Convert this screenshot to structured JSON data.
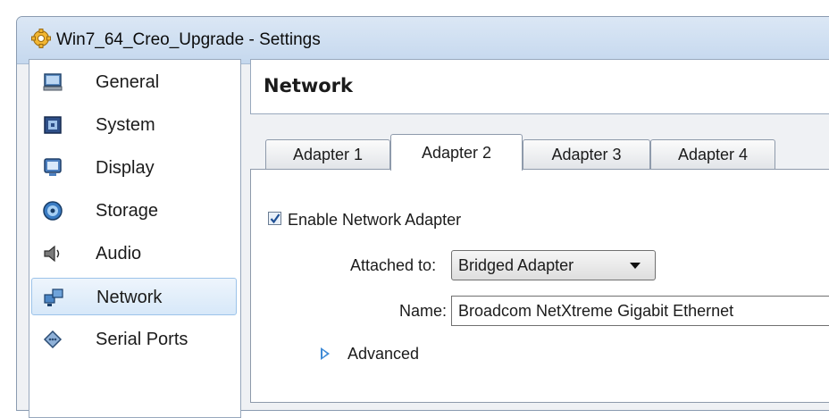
{
  "window": {
    "title": "Win7_64_Creo_Upgrade - Settings",
    "title_icon": "gear-icon"
  },
  "sidebar": {
    "items": [
      {
        "label": "General",
        "icon": "monitor-icon",
        "selected": false
      },
      {
        "label": "System",
        "icon": "chip-icon",
        "selected": false
      },
      {
        "label": "Display",
        "icon": "display-icon",
        "selected": false
      },
      {
        "label": "Storage",
        "icon": "disk-icon",
        "selected": false
      },
      {
        "label": "Audio",
        "icon": "speaker-icon",
        "selected": false
      },
      {
        "label": "Network",
        "icon": "network-icon",
        "selected": true
      },
      {
        "label": "Serial Ports",
        "icon": "serial-port-icon",
        "selected": false
      }
    ]
  },
  "section": {
    "title": "Network"
  },
  "tabs": [
    {
      "label": "Adapter 1",
      "active": false
    },
    {
      "label": "Adapter 2",
      "active": true
    },
    {
      "label": "Adapter 3",
      "active": false
    },
    {
      "label": "Adapter 4",
      "active": false
    }
  ],
  "adapter": {
    "enable_label": "Enable Network Adapter",
    "enabled": true,
    "attached_label": "Attached to:",
    "attached_value": "Bridged Adapter",
    "name_label": "Name:",
    "name_value": "Broadcom NetXtreme Gigabit Ethernet",
    "advanced_label": "Advanced"
  },
  "colors": {
    "selection_border": "#9cc3ea",
    "expander_arrow": "#3e8ad6",
    "titlebar": "#c5d8ee"
  }
}
